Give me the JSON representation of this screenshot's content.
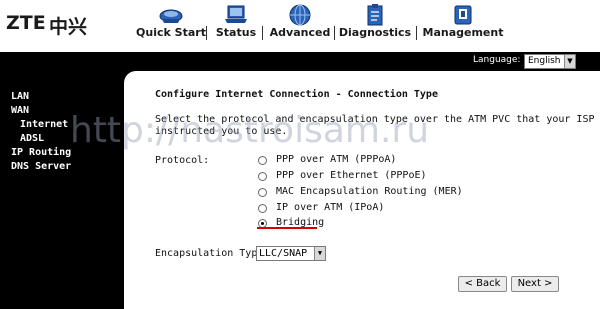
{
  "brand": {
    "latin": "ZTE",
    "cjk": "中兴"
  },
  "nav": [
    {
      "label": "Quick Start",
      "icon": "quick-start-icon"
    },
    {
      "label": "Status",
      "icon": "laptop-icon"
    },
    {
      "label": "Advanced",
      "icon": "globe-icon"
    },
    {
      "label": "Diagnostics",
      "icon": "clipboard-icon"
    },
    {
      "label": "Management",
      "icon": "device-icon"
    }
  ],
  "language": {
    "label": "Language:",
    "selected": "English"
  },
  "sidebar": {
    "items": [
      {
        "label": "LAN"
      },
      {
        "label": "WAN"
      },
      {
        "label": "Internet"
      },
      {
        "label": "ADSL"
      },
      {
        "label": "IP Routing"
      },
      {
        "label": "DNS Server"
      }
    ]
  },
  "main": {
    "title": "Configure Internet Connection - Connection Type",
    "description_lines": [
      "Select the protocol and encapsulation type over the ATM PVC that your ISP has",
      "instructed you to use."
    ],
    "protocol_label": "Protocol:",
    "protocols": [
      {
        "label": "PPP over ATM (PPPoA)",
        "checked": false
      },
      {
        "label": "PPP over Ethernet (PPPoE)",
        "checked": false
      },
      {
        "label": "MAC Encapsulation Routing (MER)",
        "checked": false
      },
      {
        "label": "IP over ATM (IPoA)",
        "checked": false
      },
      {
        "label": "Bridging",
        "checked": true
      }
    ],
    "encapsulation_label": "Encapsulation Type:",
    "encapsulation_value": "LLC/SNAP",
    "back_label": "< Back",
    "next_label": "Next >"
  },
  "watermark": "http://nastroisam.ru",
  "colors": {
    "sidebar_bg": "#000000",
    "highlight_underline": "#d40000"
  }
}
